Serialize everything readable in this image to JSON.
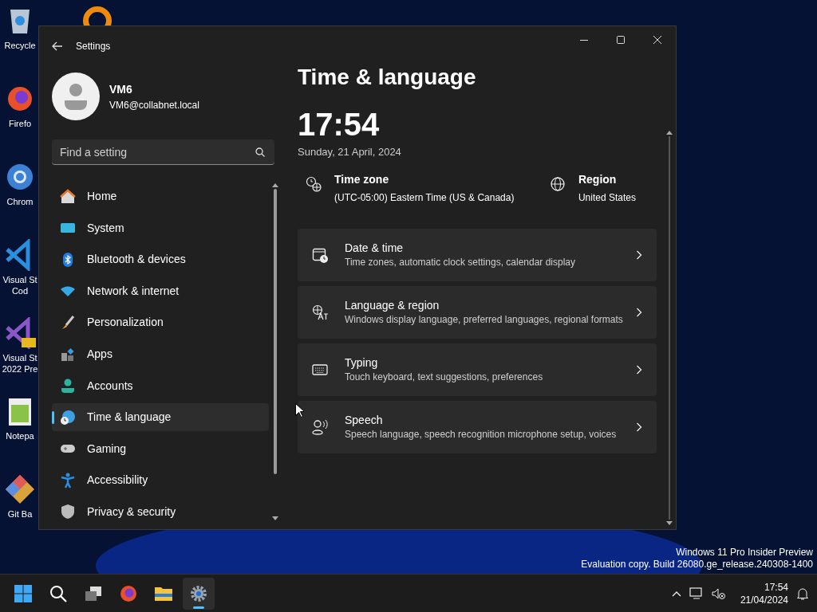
{
  "desktop_icons": [
    {
      "kind": "recycle",
      "label": "Recycle"
    },
    {
      "kind": "firefox",
      "label": "Firefo"
    },
    {
      "kind": "chrome",
      "label": "Chrom"
    },
    {
      "kind": "vscode",
      "label": "Visual St Cod"
    },
    {
      "kind": "vs",
      "label": "Visual St 2022 Pre"
    },
    {
      "kind": "notepad",
      "label": "Notepa"
    },
    {
      "kind": "git",
      "label": "Git Ba"
    }
  ],
  "window": {
    "title": "Settings",
    "user": {
      "name": "VM6",
      "email": "VM6@collabnet.local"
    },
    "search": {
      "placeholder": "Find a setting"
    },
    "nav": [
      {
        "kind": "home",
        "label": "Home",
        "selected": false
      },
      {
        "kind": "system",
        "label": "System",
        "selected": false
      },
      {
        "kind": "bluetooth",
        "label": "Bluetooth & devices",
        "selected": false
      },
      {
        "kind": "network",
        "label": "Network & internet",
        "selected": false
      },
      {
        "kind": "brush",
        "label": "Personalization",
        "selected": false
      },
      {
        "kind": "apps",
        "label": "Apps",
        "selected": false
      },
      {
        "kind": "accounts",
        "label": "Accounts",
        "selected": false
      },
      {
        "kind": "time",
        "label": "Time & language",
        "selected": true
      },
      {
        "kind": "gaming",
        "label": "Gaming",
        "selected": false
      },
      {
        "kind": "accessibility",
        "label": "Accessibility",
        "selected": false
      },
      {
        "kind": "shield",
        "label": "Privacy & security",
        "selected": false
      }
    ],
    "page_title": "Time & language",
    "clock": "17:54",
    "date": "Sunday, 21 April, 2024",
    "info": [
      {
        "kind": "timezone",
        "label": "Time zone",
        "value": "(UTC-05:00) Eastern Time (US & Canada)"
      },
      {
        "kind": "globe",
        "label": "Region",
        "value": "United States"
      }
    ],
    "cards": [
      {
        "kind": "calendar",
        "title": "Date & time",
        "description": "Time zones, automatic clock settings, calendar display"
      },
      {
        "kind": "language",
        "title": "Language & region",
        "description": "Windows display language, preferred languages, regional formats"
      },
      {
        "kind": "keyboard",
        "title": "Typing",
        "description": "Touch keyboard, text suggestions, preferences"
      },
      {
        "kind": "speech",
        "title": "Speech",
        "description": "Speech language, speech recognition microphone setup, voices"
      }
    ]
  },
  "watermark": [
    "Windows 11 Pro Insider Preview",
    "Evaluation copy. Build 26080.ge_release.240308-1400"
  ],
  "taskbar": {
    "apps": [
      {
        "kind": "start",
        "selected": false
      },
      {
        "kind": "search",
        "selected": false
      },
      {
        "kind": "taskview",
        "selected": false
      },
      {
        "kind": "firefox",
        "selected": false
      },
      {
        "kind": "explorer",
        "selected": false
      },
      {
        "kind": "settings",
        "selected": true
      }
    ],
    "time": "17:54",
    "date": "21/04/2024"
  }
}
